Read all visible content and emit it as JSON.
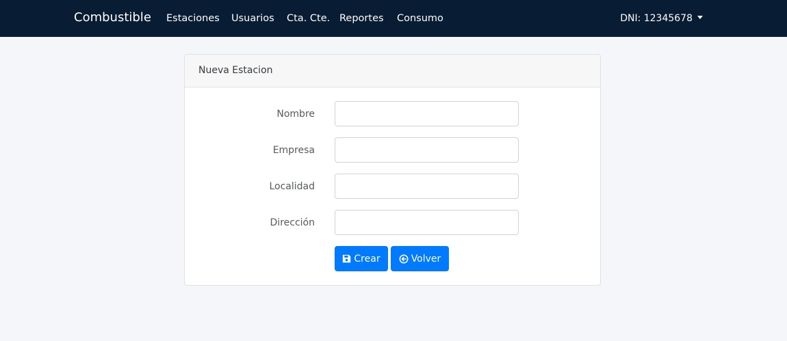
{
  "navbar": {
    "brand": "Combustible",
    "links": [
      {
        "label": "Estaciones"
      },
      {
        "label": "Usuarios"
      },
      {
        "label": "Cta. Cte."
      },
      {
        "label": "Reportes"
      },
      {
        "label": "Consumo"
      }
    ],
    "user_menu": "DNI: 12345678"
  },
  "card": {
    "header": "Nueva Estacion",
    "fields": [
      {
        "label": "Nombre",
        "value": ""
      },
      {
        "label": "Empresa",
        "value": ""
      },
      {
        "label": "Localidad",
        "value": ""
      },
      {
        "label": "Dirección",
        "value": ""
      }
    ],
    "buttons": {
      "create": "Crear",
      "back": "Volver"
    }
  },
  "colors": {
    "navbar_bg": "#081c33",
    "page_bg": "#f4f6f9",
    "primary": "#007bff"
  },
  "icons": {
    "create": "save-icon",
    "back": "arrow-circle-left-icon"
  }
}
